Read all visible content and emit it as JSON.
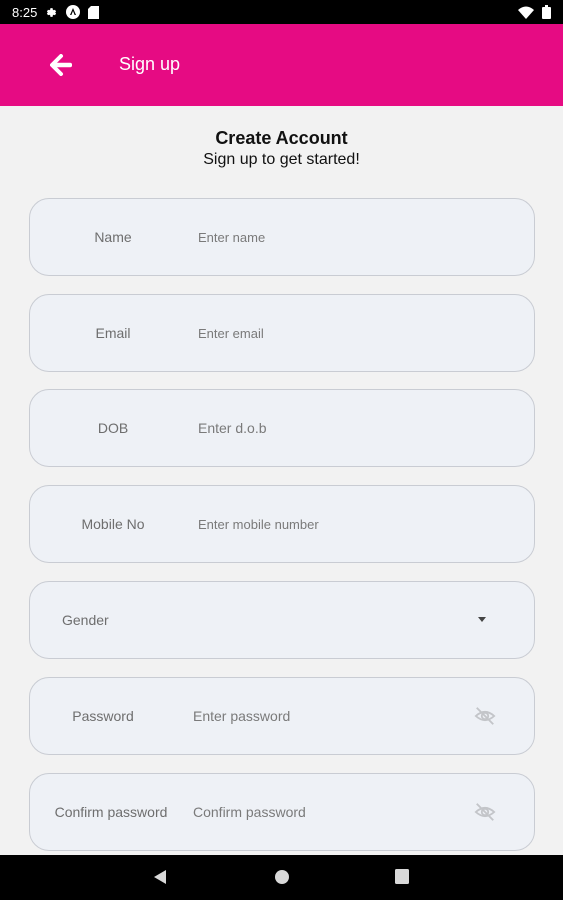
{
  "status_bar": {
    "time": "8:25"
  },
  "app_bar": {
    "title": "Sign up",
    "background_color": "#e60b83"
  },
  "header": {
    "title": "Create Account",
    "subtitle": "Sign up to get started!"
  },
  "form": {
    "name": {
      "label": "Name",
      "placeholder": "Enter name"
    },
    "email": {
      "label": "Email",
      "placeholder": "Enter email"
    },
    "dob": {
      "label": "DOB",
      "placeholder": "Enter d.o.b"
    },
    "mobile": {
      "label": "Mobile No",
      "placeholder": "Enter mobile number"
    },
    "gender": {
      "label": "Gender"
    },
    "password": {
      "label": "Password",
      "placeholder": "Enter password"
    },
    "confirm_password": {
      "label": "Confirm password",
      "placeholder": "Confirm password"
    }
  },
  "icons": {
    "back": "arrow-back-icon",
    "dropdown": "chevron-down-icon",
    "visibility": "eye-off-icon",
    "nav": [
      "back-triangle-icon",
      "home-circle-icon",
      "recents-square-icon"
    ]
  }
}
